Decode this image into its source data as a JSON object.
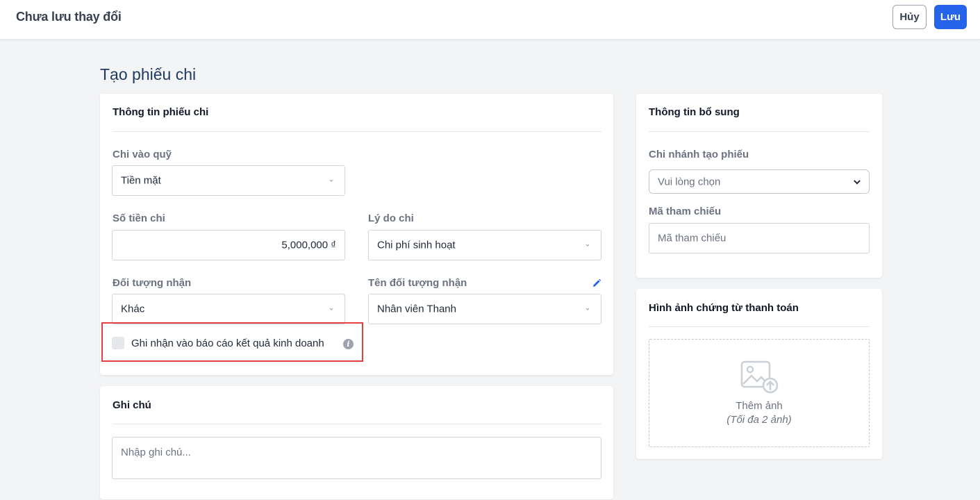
{
  "header": {
    "title": "Chưa lưu thay đổi",
    "cancel_label": "Hủy",
    "save_label": "Lưu",
    "accent_color": "#2563eb"
  },
  "page": {
    "title": "Tạo phiếu chi"
  },
  "main_card": {
    "title": "Thông tin phiếu chi",
    "fund_label": "Chi vào quỹ",
    "fund_value": "Tiền mặt",
    "amount_label": "Số tiền chi",
    "amount_value": "5,000,000 ₫",
    "reason_label": "Lý do chi",
    "reason_value": "Chi phí sinh hoạt",
    "recipient_type_label": "Đối tượng nhận",
    "recipient_type_value": "Khác",
    "recipient_name_label": "Tên đối tượng nhận",
    "recipient_name_value": "Nhân viên Thanh",
    "record_checkbox_label": "Ghi nhận vào báo cáo kết quả kinh doanh",
    "record_checkbox_checked": false,
    "info_icon_glyph": "i"
  },
  "notes_card": {
    "title": "Ghi chú",
    "placeholder": "Nhập ghi chú..."
  },
  "extra_card": {
    "title": "Thông tin bổ sung",
    "branch_label": "Chi nhánh tạo phiếu",
    "branch_placeholder": "Vui lòng chọn",
    "reference_label": "Mã tham chiếu",
    "reference_placeholder": "Mã tham chiếu"
  },
  "image_card": {
    "title": "Hình ảnh chứng từ thanh toán",
    "add_label": "Thêm ảnh",
    "limit_note": "(Tối đa 2 ảnh)"
  },
  "icons": {
    "chevron": "chevron-down-icon",
    "edit": "pencil-icon",
    "info": "info-icon",
    "upload": "image-upload-icon"
  }
}
